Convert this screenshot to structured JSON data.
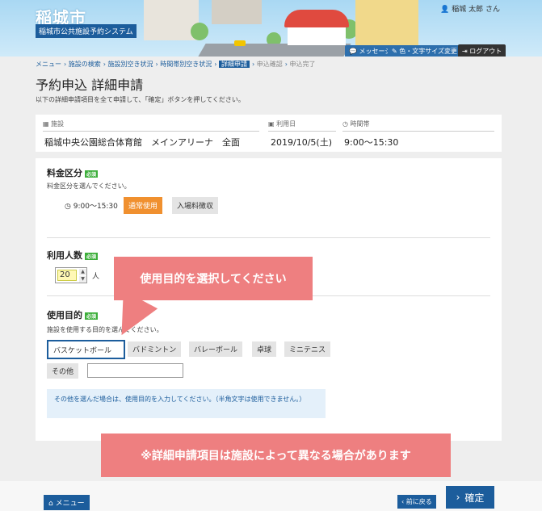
{
  "header": {
    "logo": "稲城市",
    "system_name": "稲城市公共施設予約システム",
    "user": "稲城 太郎 さん",
    "message_label": "メッセージ",
    "text_size_label": "色・文字サイズ変更",
    "logout_label": "ログアウト"
  },
  "breadcrumb": [
    "メニュー",
    "施設の検索",
    "施設別空き状況",
    "時間帯別空き状況",
    "詳細申請",
    "申込確認",
    "申込完了"
  ],
  "page": {
    "title": "予約申込 詳細申請",
    "intro": "以下の詳細申請項目を全て申請して、「確定」ボタンを押してください。"
  },
  "facility": {
    "facility_label": "施設",
    "facility_value": "稲城中央公園総合体育館　メインアリーナ　全面",
    "date_label": "利用日",
    "date_value": "2019/10/5(土)",
    "time_label": "時間帯",
    "time_value": "9:00〜15:30"
  },
  "fee": {
    "heading": "料金区分",
    "required": "必須",
    "desc": "料金区分を選んでください。",
    "time": "9:00〜15:30",
    "options": [
      "通常使用",
      "入場料徴収"
    ]
  },
  "people": {
    "heading": "利用人数",
    "required": "必須",
    "value": "20",
    "unit": "人"
  },
  "purpose": {
    "heading": "使用目的",
    "required": "必須",
    "desc": "施設を使用する目的を選んでください。",
    "options": [
      "バスケットボール",
      "バドミントン",
      "バレーボール",
      "卓球",
      "ミニテニス",
      "その他"
    ],
    "note": "その他を選んだ場合は、使用目的を入力してください。（半角文字は使用できません。）"
  },
  "callouts": {
    "select_purpose": "使用目的を選択してください",
    "detail_note": "※詳細申請項目は施設によって異なる場合があります"
  },
  "footer": {
    "menu_label": "メニュー",
    "back_label": "前に戻る",
    "confirm_label": "確定"
  },
  "colors": {
    "primary": "#1c5d9c",
    "selected_fee": "#f0902f",
    "callout": "#ee7f80",
    "required_badge": "#3cae3a"
  }
}
